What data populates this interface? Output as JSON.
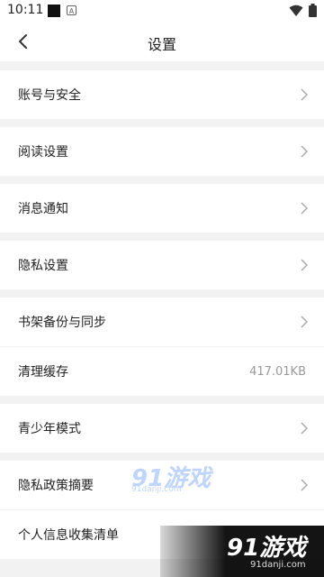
{
  "status_bar": {
    "time": "10:11",
    "notif_letter": "A"
  },
  "header": {
    "title": "设置"
  },
  "rows": [
    {
      "label": "账号与安全"
    },
    {
      "label": "阅读设置"
    },
    {
      "label": "消息通知"
    },
    {
      "label": "隐私设置"
    },
    {
      "label": "书架备份与同步"
    },
    {
      "label": "清理缓存",
      "value": "417.01KB"
    },
    {
      "label": "青少年模式"
    },
    {
      "label": "隐私政策摘要"
    },
    {
      "label": "个人信息收集清单"
    }
  ],
  "watermark": {
    "brand": "91游戏",
    "site": "91danji.com"
  },
  "colors": {
    "background": "#f2f2f2",
    "surface": "#ffffff",
    "muted_text": "#9a9a9a"
  }
}
